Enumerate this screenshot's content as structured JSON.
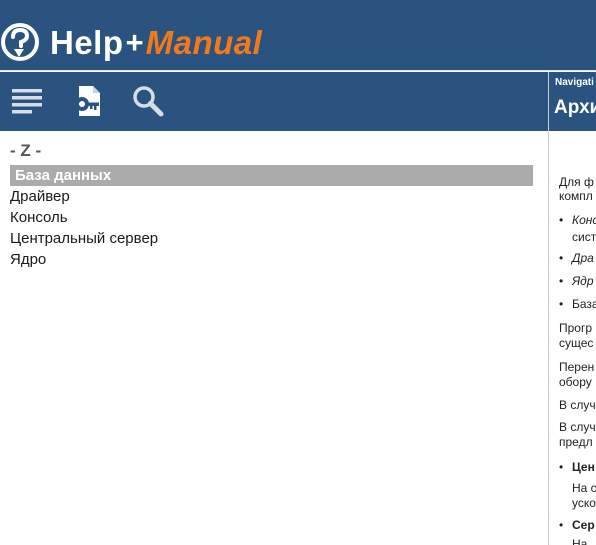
{
  "header": {
    "logo_help": "Help",
    "logo_plus": "+",
    "logo_manual": "Manual"
  },
  "toolbar": {
    "buttons": [
      {
        "name": "toc",
        "icon": "list-icon"
      },
      {
        "name": "index",
        "icon": "document-key-icon"
      },
      {
        "name": "search",
        "icon": "search-icon"
      }
    ]
  },
  "index": {
    "letter": "- Z -",
    "items": [
      {
        "label": "База данных",
        "selected": true
      },
      {
        "label": "Драйвер",
        "selected": false
      },
      {
        "label": "Консоль",
        "selected": false
      },
      {
        "label": "Центральный сервер",
        "selected": false
      },
      {
        "label": "Ядро",
        "selected": false
      }
    ]
  },
  "content": {
    "nav_label": "Navigati",
    "title": "Архи",
    "lines": [
      "Для ф",
      "компл",
      "Конс",
      "сист",
      "Дра",
      "Ядр",
      "База",
      "Прогр",
      "сущес",
      "Перен",
      "обору",
      "В случ",
      "В случ",
      "предл",
      "Цен",
      "На с",
      "уско",
      "Сер",
      "На"
    ]
  },
  "colors": {
    "header_bg": "#2a5380",
    "logo_accent": "#f07a1a",
    "selected_bg": "#ababab"
  }
}
